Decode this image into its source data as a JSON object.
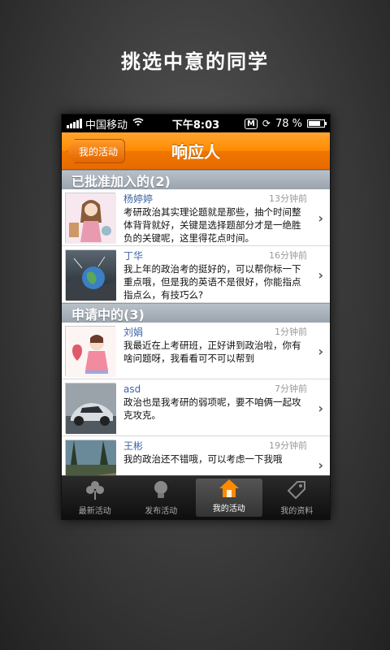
{
  "headline": "挑选中意的同学",
  "statusbar": {
    "carrier": "中国移动",
    "time": "下午8:03",
    "battery": "78 %",
    "battery_level": 0.78
  },
  "navbar": {
    "back_label": "我的活动",
    "title": "响应人"
  },
  "sections": [
    {
      "title": "已批准加入的(2)",
      "items": [
        {
          "name": "杨婷婷",
          "time": "13分钟前",
          "text": "考研政治其实理论题就是那些，抽个时间整体背背就好，关键是选择题部分才是一绝胜负的关键呢，这里得花点时间。"
        },
        {
          "name": "丁华",
          "time": "16分钟前",
          "text": "我上年的政治考的挺好的，可以帮你标一下重点哦，但是我的英语不是很好，你能指点指点么，有技巧么?"
        }
      ]
    },
    {
      "title": "申请中的(3)",
      "items": [
        {
          "name": "刘娟",
          "time": "1分钟前",
          "text": "我最近在上考研班，正好讲到政治啦，你有啥问题呀，我看看可不可以帮到"
        },
        {
          "name": "asd",
          "time": "7分钟前",
          "text": "政治也是我考研的弱项呢，要不咱俩一起攻克攻克。"
        },
        {
          "name": "王彬",
          "time": "19分钟前",
          "text": "我的政治还不错哦，可以考虑一下我哦"
        }
      ]
    }
  ],
  "tabs": [
    {
      "label": "最新活动",
      "icon": "flower-icon"
    },
    {
      "label": "发布活动",
      "icon": "lightbulb-icon"
    },
    {
      "label": "我的活动",
      "icon": "home-icon"
    },
    {
      "label": "我的资料",
      "icon": "tag-icon"
    }
  ],
  "colors": {
    "accent": "#ff8a00",
    "link": "#3e64a6"
  }
}
